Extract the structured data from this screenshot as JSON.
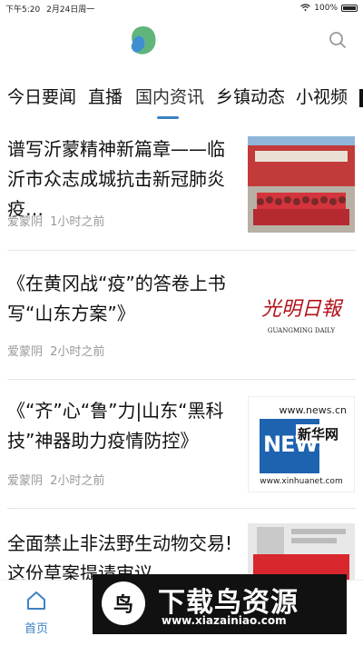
{
  "status_bar": {
    "time": "下午5:20",
    "date": "2月24日周一",
    "battery": "100%"
  },
  "tabs": [
    "今日要闻",
    "直播",
    "国内资讯",
    "乡镇动态",
    "小视频"
  ],
  "active_tab_index": 2,
  "news": [
    {
      "title": "谱写沂蒙精神新篇章——临沂市众志成城抗击新冠肺炎疫…",
      "author": "爱蒙阴",
      "time": "1小时之前",
      "thumb": "photo"
    },
    {
      "title": "《在黄冈战“疫”的答卷上书写“山东方案”》",
      "author": "爱蒙阴",
      "time": "2小时之前",
      "thumb": "guangming",
      "thumb_text": "光明日報",
      "thumb_sub": "GUANGMING DAILY"
    },
    {
      "title": "《“齐”心“鲁”力|山东“黑科技”神器助力疫情防控》",
      "author": "爱蒙阴",
      "time": "2小时之前",
      "thumb": "xinhua",
      "thumb_top": "www.news.cn",
      "thumb_mid": "新华网",
      "thumb_bottom": "www.xinhuanet.com",
      "thumb_letters": "NEWS"
    },
    {
      "title": "全面禁止非法野生动物交易!这份草案提请审议",
      "author": "",
      "time": "",
      "thumb": "newspaper"
    }
  ],
  "bottom_nav": {
    "home_label": "首页"
  },
  "watermark": {
    "text": "下载鸟资源",
    "url": "www.xiazainiao.com",
    "logo_char": "鸟"
  },
  "colors": {
    "accent": "#3b82c4",
    "meta": "#999999"
  }
}
